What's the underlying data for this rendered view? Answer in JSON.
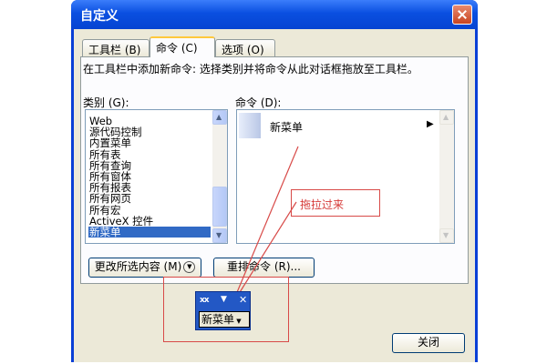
{
  "dialog": {
    "title": "自定义",
    "tabs": [
      {
        "label": "工具栏 (B)",
        "active": false
      },
      {
        "label": "命令 (C)",
        "active": true
      },
      {
        "label": "选项 (O)",
        "active": false
      }
    ],
    "instruction": "在工具栏中添加新命令: 选择类别并将命令从此对话框拖放至工具栏。",
    "categories_label": "类别 (G):",
    "commands_label": "命令 (D):",
    "categories": [
      "Web",
      "源代码控制",
      "内置菜单",
      "所有表",
      "所有查询",
      "所有窗体",
      "所有报表",
      "所有网页",
      "所有宏",
      "ActiveX 控件",
      "新菜单"
    ],
    "selected_category": "新菜单",
    "commands": [
      {
        "label": "新菜单",
        "has_submenu_arrow": "▶"
      }
    ],
    "modify_button": "更改所选内容 (M)",
    "rearrange_button": "重排命令 (R)...",
    "close_button": "关闭",
    "colors": {
      "title_bar": "#0a4fe0",
      "selection": "#316ac5",
      "annotation": "#d84a48"
    }
  },
  "annotation": {
    "note": "拖拉过来"
  },
  "floating_toolbar": {
    "grip": "xx",
    "dropdown_glyph": "▼",
    "close_glyph": "✕",
    "item_label": "新菜单"
  }
}
